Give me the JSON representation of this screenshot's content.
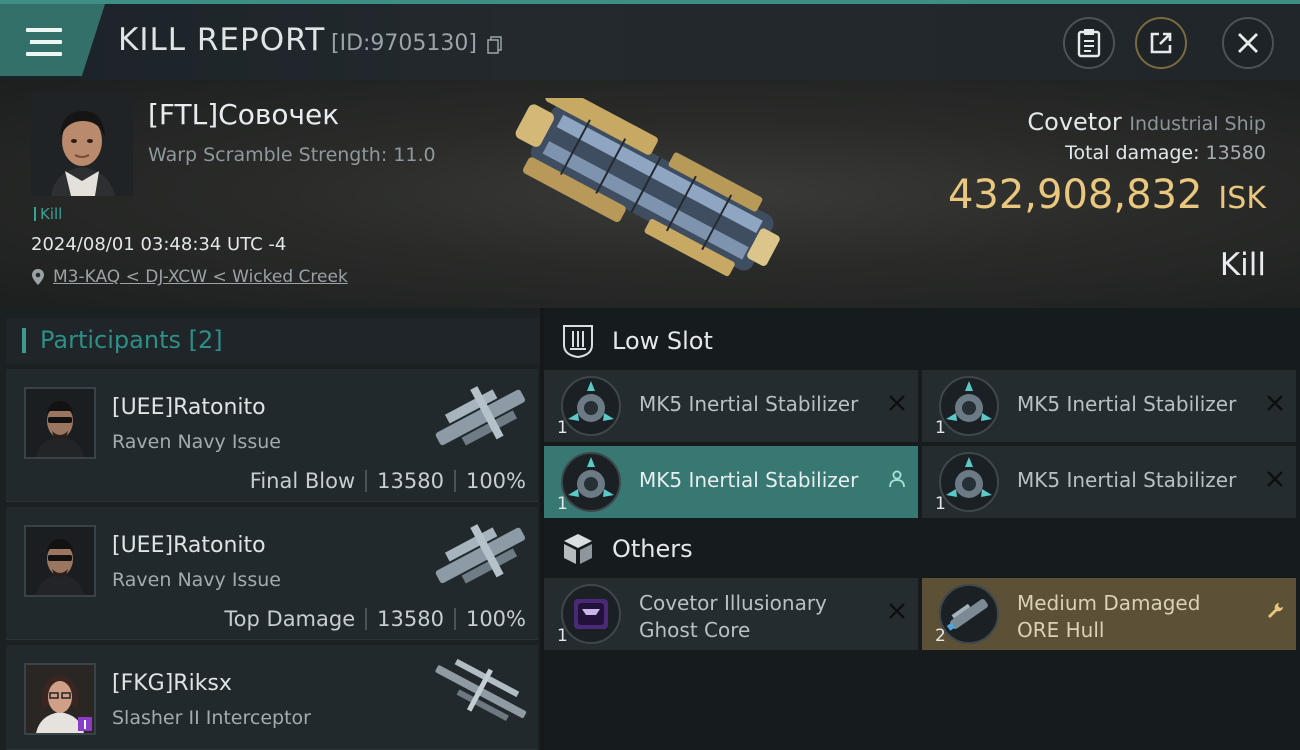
{
  "header": {
    "title": "KILL REPORT",
    "report_id": "[ID:9705130]"
  },
  "victim": {
    "name": "[FTL]Совочек",
    "scram": "Warp Scramble Strength: 11.0",
    "tag": "Kill",
    "timestamp": "2024/08/01 03:48:34 UTC -4",
    "location": "M3-KAQ < DJ-XCW < Wicked Creek",
    "ship_name": "Covetor",
    "ship_class": "Industrial Ship",
    "total_damage_label": "Total damage:",
    "total_damage": "13580",
    "isk_value": "432,908,832",
    "isk_unit": "ISK",
    "result": "Kill"
  },
  "participants": {
    "title": "Participants",
    "count": "[2]",
    "items": [
      {
        "name": "[UEE]Ratonito",
        "ship": "Raven Navy Issue",
        "role": "Final Blow",
        "damage": "13580",
        "percent": "100%"
      },
      {
        "name": "[UEE]Ratonito",
        "ship": "Raven Navy Issue",
        "role": "Top Damage",
        "damage": "13580",
        "percent": "100%"
      },
      {
        "name": "[FKG]Riksx",
        "ship": "Slasher II Interceptor"
      }
    ]
  },
  "low_slot": {
    "title": "Low Slot",
    "items": [
      {
        "name": "MK5 Inertial Stabilizer",
        "qty": "1"
      },
      {
        "name": "MK5 Inertial Stabilizer",
        "qty": "1"
      },
      {
        "name": "MK5 Inertial Stabilizer",
        "qty": "1"
      },
      {
        "name": "MK5 Inertial Stabilizer",
        "qty": "1"
      }
    ]
  },
  "others": {
    "title": "Others",
    "items": [
      {
        "name_line1": "Covetor Illusionary",
        "name_line2": "Ghost Core",
        "qty": "1"
      },
      {
        "name_line1": "Medium Damaged",
        "name_line2": "ORE Hull",
        "qty": "2"
      }
    ]
  },
  "colors": {
    "accent": "#3d9a90",
    "isk": "#e9c77e",
    "active_slot": "#387872",
    "gold_slot": "#5c5036"
  }
}
